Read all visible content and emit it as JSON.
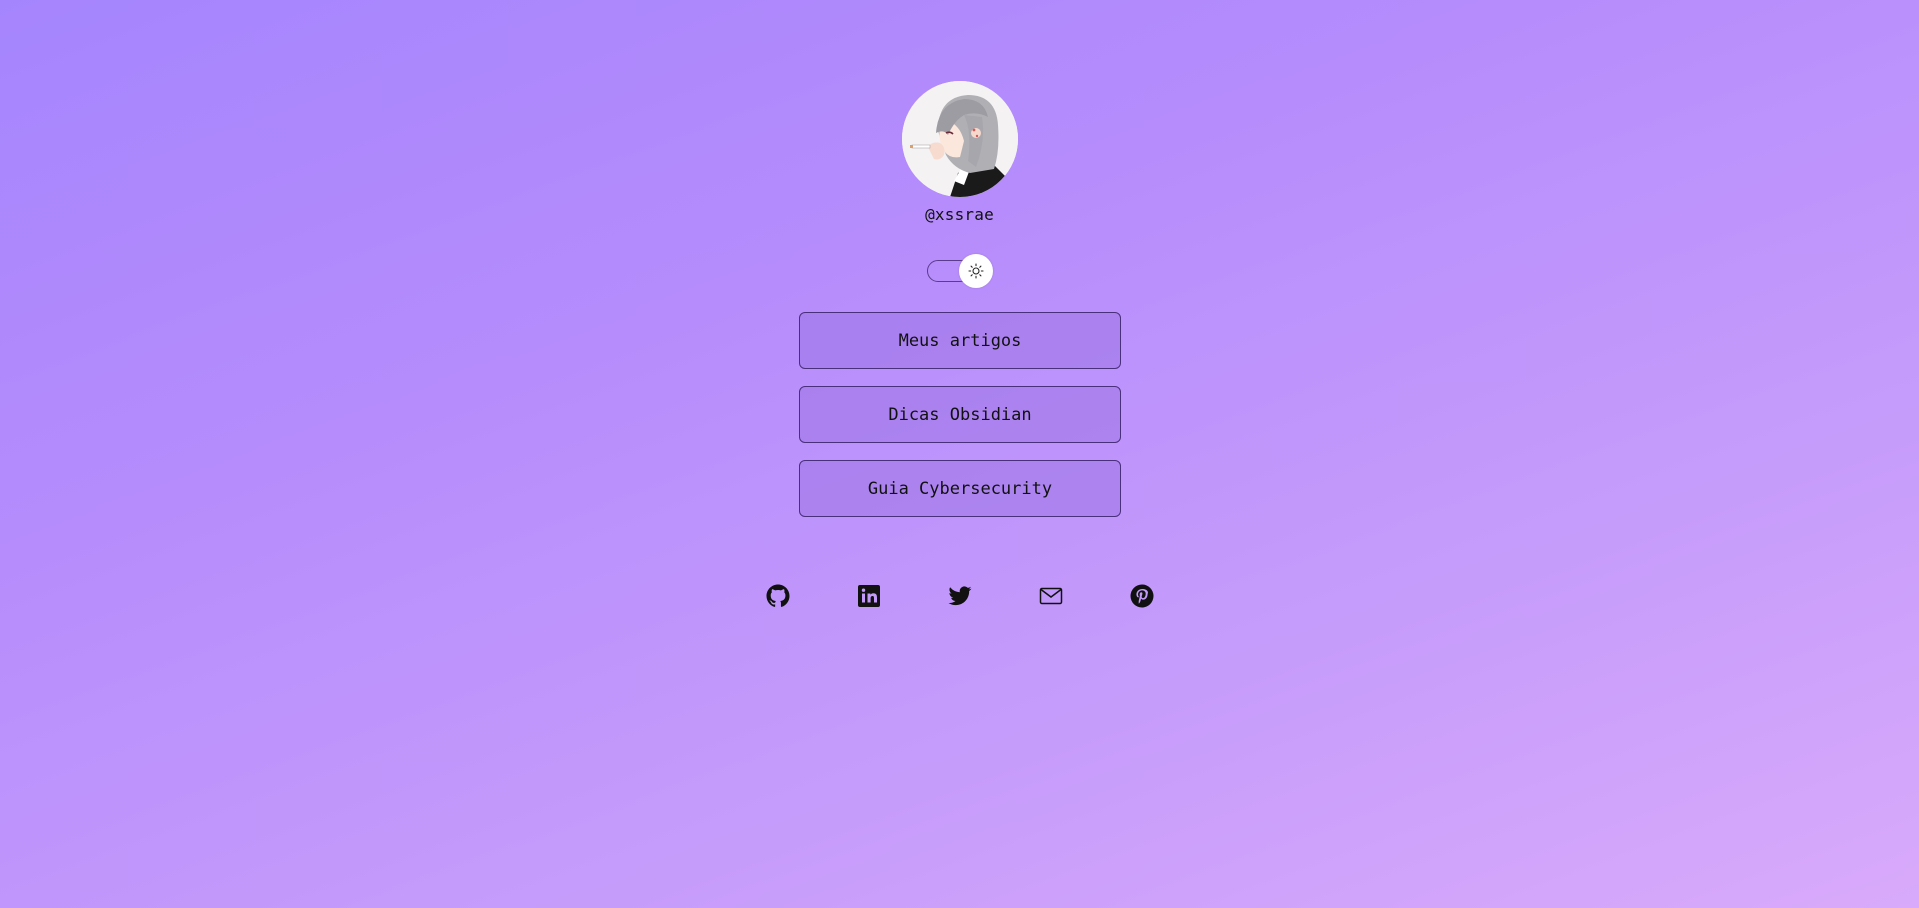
{
  "profile": {
    "handle": "@xssrae",
    "avatar_alt": "avatar"
  },
  "theme_toggle": {
    "icon": "sun-icon",
    "state": "light"
  },
  "links": [
    {
      "label": "Meus artigos"
    },
    {
      "label": "Dicas Obsidian"
    },
    {
      "label": "Guia Cybersecurity"
    }
  ],
  "socials": [
    {
      "icon": "github-icon"
    },
    {
      "icon": "linkedin-icon"
    },
    {
      "icon": "twitter-icon"
    },
    {
      "icon": "mail-icon"
    },
    {
      "icon": "pinterest-icon"
    }
  ],
  "colors": {
    "background_start": "#a585fd",
    "background_end": "#d9aafb",
    "button_border": "#4a2f7a",
    "text": "#111111"
  }
}
